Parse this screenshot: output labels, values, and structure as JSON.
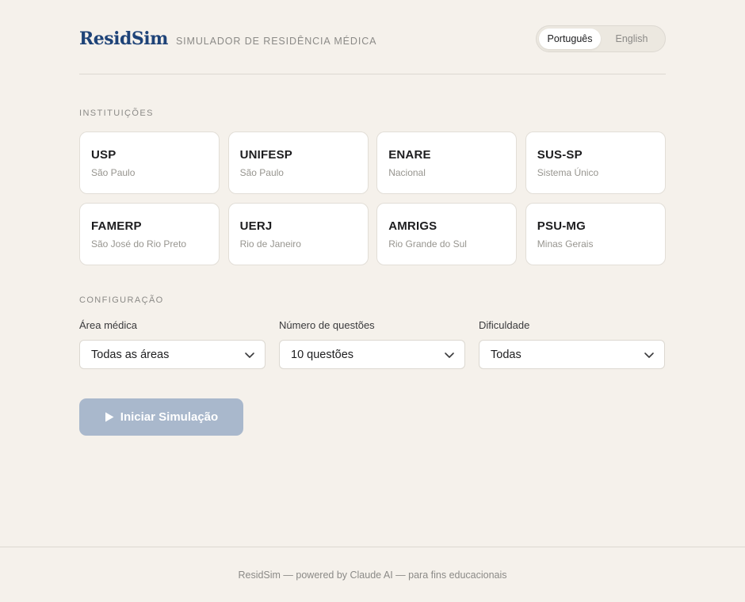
{
  "header": {
    "logo": "ResidSim",
    "tagline": "Simulador de Residência Médica",
    "languages": [
      {
        "label": "Português",
        "active": true
      },
      {
        "label": "English",
        "active": false
      }
    ]
  },
  "institutions": {
    "section_label": "Instituições",
    "items": [
      {
        "name": "USP",
        "region": "São Paulo"
      },
      {
        "name": "UNIFESP",
        "region": "São Paulo"
      },
      {
        "name": "ENARE",
        "region": "Nacional"
      },
      {
        "name": "SUS-SP",
        "region": "Sistema Único"
      },
      {
        "name": "FAMERP",
        "region": "São José do Rio Preto"
      },
      {
        "name": "UERJ",
        "region": "Rio de Janeiro"
      },
      {
        "name": "AMRIGS",
        "region": "Rio Grande do Sul"
      },
      {
        "name": "PSU-MG",
        "region": "Minas Gerais"
      }
    ]
  },
  "config": {
    "section_label": "Configuração",
    "fields": [
      {
        "label": "Área médica",
        "value": "Todas as áreas"
      },
      {
        "label": "Número de questões",
        "value": "10 questões"
      },
      {
        "label": "Dificuldade",
        "value": "Todas"
      }
    ]
  },
  "start_button": {
    "label": "Iniciar Simulação",
    "icon": "play-icon",
    "color": "#a9b8cc"
  },
  "footer": {
    "text": "ResidSim — powered by Claude AI — para fins educacionais"
  },
  "colors": {
    "brand": "#1e4378",
    "background": "#f5f1eb",
    "muted_text": "#8b8a87"
  }
}
